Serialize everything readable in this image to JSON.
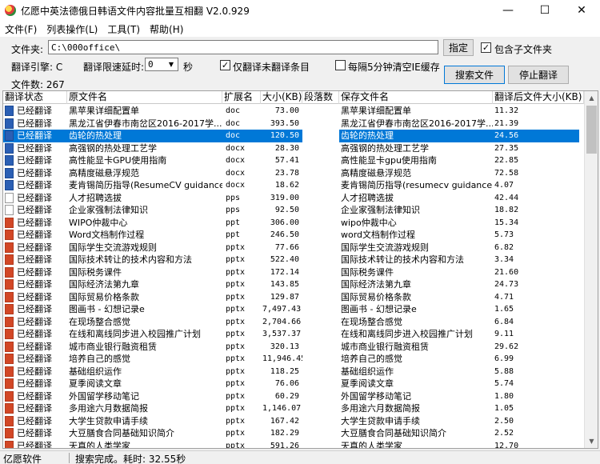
{
  "window": {
    "title": "亿愿中英法德俄日韩语文件内容批量互相翻 V2.0.929",
    "minimize": "—",
    "maximize": "☐",
    "close": "✕"
  },
  "menu": [
    "文件(F)",
    "列表操作(L)",
    "工具(T)",
    "帮助(H)"
  ],
  "controls": {
    "folder_label": "文件夹:",
    "folder_value": "C:\\000office\\",
    "specify_button": "指定",
    "include_subfolders_label": "包含子文件夹",
    "engine_label": "翻译引擎: C",
    "delay_label": "翻译限速延时:",
    "delay_value": "0",
    "delay_unit": "秒",
    "only_untranslated_label": "仅翻译未翻译条目",
    "clear_cache_label": "每隔5分钟清空IE缓存",
    "file_count_label": "文件数: 267",
    "search_button": "搜索文件",
    "stop_button": "停止翻译"
  },
  "table": {
    "headers": [
      "翻译状态",
      "原文件名",
      "扩展名",
      "大小(KB)",
      "段落数",
      "保存文件名",
      "翻译后文件大小(KB)"
    ],
    "rows": [
      {
        "status": "已经翻译",
        "src": "黑苹果详细配置单",
        "ext": "doc",
        "size": "73.00",
        "dst": "黑苹果详细配置单",
        "size2": "11.32",
        "icon": "doc"
      },
      {
        "status": "已经翻译",
        "src": "黑龙江省伊春市南岔区2016-2017学...",
        "ext": "doc",
        "size": "393.50",
        "dst": "黑龙江省伊春市南岔区2016-2017学...",
        "size2": "21.39",
        "icon": "doc"
      },
      {
        "status": "已经翻译",
        "src": "齿轮的热处理",
        "ext": "doc",
        "size": "120.50",
        "dst": "齿轮的热处理",
        "size2": "24.56",
        "icon": "doc"
      },
      {
        "status": "已经翻译",
        "src": "高强钢的热处理工艺学",
        "ext": "docx",
        "size": "28.30",
        "dst": "高强钢的热处理工艺学",
        "size2": "27.35",
        "icon": "doc"
      },
      {
        "status": "已经翻译",
        "src": "高性能显卡GPU使用指南",
        "ext": "docx",
        "size": "57.41",
        "dst": "高性能显卡gpu使用指南",
        "size2": "22.85",
        "icon": "doc"
      },
      {
        "status": "已经翻译",
        "src": "高精度磁悬浮规范",
        "ext": "docx",
        "size": "23.78",
        "dst": "高精度磁悬浮规范",
        "size2": "72.58",
        "icon": "doc"
      },
      {
        "status": "已经翻译",
        "src": "麦肯锡简历指导(ResumeCV guidance)",
        "ext": "docx",
        "size": "18.62",
        "dst": "麦肯锡简历指导(resumecv guidance)",
        "size2": "4.07",
        "icon": "doc"
      },
      {
        "status": "已经翻译",
        "src": "人才招聘选拔",
        "ext": "pps",
        "size": "319.00",
        "dst": "人才招聘选拔",
        "size2": "42.44",
        "icon": "pps"
      },
      {
        "status": "已经翻译",
        "src": "企业家强制法律知识",
        "ext": "pps",
        "size": "92.50",
        "dst": "企业家强制法律知识",
        "size2": "18.82",
        "icon": "pps"
      },
      {
        "status": "已经翻译",
        "src": "WIPO仲裁中心",
        "ext": "ppt",
        "size": "306.00",
        "dst": "wipo仲裁中心",
        "size2": "15.34",
        "icon": "ppt"
      },
      {
        "status": "已经翻译",
        "src": "Word文档制作过程",
        "ext": "ppt",
        "size": "246.50",
        "dst": "word文档制作过程",
        "size2": "5.73",
        "icon": "ppt"
      },
      {
        "status": "已经翻译",
        "src": "国际学生交流游戏规则",
        "ext": "pptx",
        "size": "77.66",
        "dst": "国际学生交流游戏规则",
        "size2": "6.82",
        "icon": "pptx"
      },
      {
        "status": "已经翻译",
        "src": "国际技术转让的技术内容和方法",
        "ext": "pptx",
        "size": "522.40",
        "dst": "国际技术转让的技术内容和方法",
        "size2": "3.34",
        "icon": "pptx"
      },
      {
        "status": "已经翻译",
        "src": "国际税务课件",
        "ext": "pptx",
        "size": "172.14",
        "dst": "国际税务课件",
        "size2": "21.60",
        "icon": "pptx"
      },
      {
        "status": "已经翻译",
        "src": "国际经济法第九章",
        "ext": "pptx",
        "size": "143.85",
        "dst": "国际经济法第九章",
        "size2": "24.73",
        "icon": "pptx"
      },
      {
        "status": "已经翻译",
        "src": "国际贸易价格条款",
        "ext": "pptx",
        "size": "129.87",
        "dst": "国际贸易价格条款",
        "size2": "4.71",
        "icon": "pptx"
      },
      {
        "status": "已经翻译",
        "src": "图画书 - 幻想记录e",
        "ext": "pptx",
        "size": "7,497.43",
        "dst": "图画书 - 幻想记录e",
        "size2": "1.65",
        "icon": "pptx"
      },
      {
        "status": "已经翻译",
        "src": "在现场整合感觉",
        "ext": "pptx",
        "size": "2,704.66",
        "dst": "在现场整合感觉",
        "size2": "6.84",
        "icon": "pptx"
      },
      {
        "status": "已经翻译",
        "src": "在线和离线同步进入校园推广计划",
        "ext": "pptx",
        "size": "3,537.37",
        "dst": "在线和离线同步进入校园推广计划",
        "size2": "9.11",
        "icon": "pptx"
      },
      {
        "status": "已经翻译",
        "src": "城市商业银行融资租赁",
        "ext": "pptx",
        "size": "320.13",
        "dst": "城市商业银行融资租赁",
        "size2": "29.62",
        "icon": "pptx"
      },
      {
        "status": "已经翻译",
        "src": "培养自己的感觉",
        "ext": "pptx",
        "size": "11,946.45",
        "dst": "培养自己的感觉",
        "size2": "6.99",
        "icon": "pptx"
      },
      {
        "status": "已经翻译",
        "src": "基础组织运作",
        "ext": "pptx",
        "size": "118.25",
        "dst": "基础组织运作",
        "size2": "5.88",
        "icon": "pptx"
      },
      {
        "status": "已经翻译",
        "src": "夏季阅读文章",
        "ext": "pptx",
        "size": "76.06",
        "dst": "夏季阅读文章",
        "size2": "5.74",
        "icon": "pptx"
      },
      {
        "status": "已经翻译",
        "src": "外国留学移动笔记",
        "ext": "pptx",
        "size": "60.29",
        "dst": "外国留学移动笔记",
        "size2": "1.80",
        "icon": "pptx"
      },
      {
        "status": "已经翻译",
        "src": "多用途六月数据简报",
        "ext": "pptx",
        "size": "1,146.07",
        "dst": "多用途六月数据简报",
        "size2": "1.05",
        "icon": "pptx"
      },
      {
        "status": "已经翻译",
        "src": "大学生贷款申请手续",
        "ext": "pptx",
        "size": "167.42",
        "dst": "大学生贷款申请手续",
        "size2": "2.50",
        "icon": "pptx"
      },
      {
        "status": "已经翻译",
        "src": "大豆膳食合同基础知识简介",
        "ext": "pptx",
        "size": "182.29",
        "dst": "大豆膳食合同基础知识简介",
        "size2": "2.52",
        "icon": "pptx"
      },
      {
        "status": "已经翻译",
        "src": "天真的人类学家",
        "ext": "pptx",
        "size": "591.26",
        "dst": "天真的人类学家",
        "size2": "12.70",
        "icon": "pptx"
      }
    ]
  },
  "statusbar": {
    "left": "亿愿软件",
    "message": "搜索完成。耗时: 32.55秒"
  }
}
